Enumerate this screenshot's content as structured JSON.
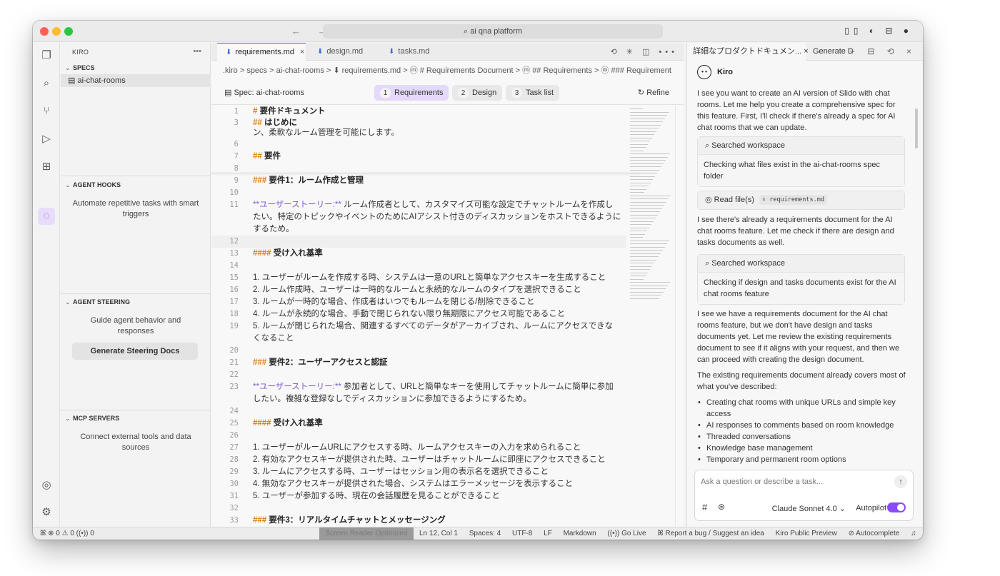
{
  "titlebar": {
    "nav": "← →",
    "search": "⌕ ai qna platform",
    "right_icons": "▯▯ ◐ ⊟ ●"
  },
  "activity": {
    "icons": [
      "explorer-icon",
      "search-icon",
      "source-control-icon",
      "run-debug-icon",
      "extensions-icon",
      "kiro-ghost-icon",
      "account-icon",
      "settings-icon"
    ]
  },
  "sidebar": {
    "header": "KIRO",
    "more": "•••",
    "specs": {
      "title": "SPECS",
      "item": "ai-chat-rooms"
    },
    "hooks": {
      "title": "AGENT HOOKS",
      "desc": "Automate repetitive tasks with smart triggers"
    },
    "steering": {
      "title": "AGENT STEERING",
      "desc": "Guide agent behavior and responses",
      "button": "Generate Steering Docs"
    },
    "mcp": {
      "title": "MCP SERVERS",
      "desc": "Connect external tools and data sources"
    }
  },
  "editor": {
    "tabs": [
      {
        "label": "requirements.md",
        "close": "×"
      },
      {
        "label": "design.md"
      },
      {
        "label": "tasks.md"
      }
    ],
    "tab_actions": "⟲ ✳ ◫ •••",
    "breadcrumb": ".kiro > specs > ai-chat-rooms > ⬇ requirements.md > ⓜ # Requirements Document > ⓜ ## Requirements > ⓜ ### Requirement",
    "spec_label": "Spec: ai-chat-rooms",
    "steps": [
      {
        "num": "1",
        "label": "Requirements"
      },
      {
        "num": "2",
        "label": "Design"
      },
      {
        "num": "3",
        "label": "Task list"
      }
    ],
    "refine": "↻ Refine",
    "lines": [
      {
        "n": "1",
        "hash": "#",
        "text": "要件ドキュメント"
      },
      {
        "n": "3",
        "hash": "##",
        "text": "はじめに"
      },
      {
        "n": "",
        "text": "ン、柔軟なルーム管理を可能にします。"
      },
      {
        "n": "6",
        "text": ""
      },
      {
        "n": "7",
        "hash": "##",
        "text": "要件"
      },
      {
        "n": "8",
        "text": ""
      },
      {
        "n": "9",
        "hash": "###",
        "text": "要件1：ルーム作成と管理"
      },
      {
        "n": "10",
        "text": ""
      },
      {
        "n": "11",
        "bold": "**ユーザーストーリー:**",
        "text": "ルーム作成者として、カスタマイズ可能な設定でチャットルームを作成し"
      },
      {
        "n": "",
        "text": "たい。特定のトピックやイベントのためにAIアシスト付きのディスカッションをホストできるように"
      },
      {
        "n": "",
        "text": "するため。"
      },
      {
        "n": "12",
        "text": ""
      },
      {
        "n": "13",
        "hash": "####",
        "text": "受け入れ基準"
      },
      {
        "n": "14",
        "text": ""
      },
      {
        "n": "15",
        "text": "1. ユーザーがルームを作成する時、システムは一意のURLと簡単なアクセスキーを生成すること"
      },
      {
        "n": "16",
        "text": "2. ルーム作成時、ユーザーは一時的なルームと永続的なルームのタイプを選択できること"
      },
      {
        "n": "17",
        "text": "3. ルームが一時的な場合、作成者はいつでもルームを閉じる/削除できること"
      },
      {
        "n": "18",
        "text": "4. ルームが永続的な場合、手動で閉じられない限り無期限にアクセス可能であること"
      },
      {
        "n": "19",
        "text": "5. ルームが閉じられた場合、関連するすべてのデータがアーカイブされ、ルームにアクセスできな"
      },
      {
        "n": "",
        "text": "くなること"
      },
      {
        "n": "20",
        "text": ""
      },
      {
        "n": "21",
        "hash": "###",
        "text": "要件2：ユーザーアクセスと認証"
      },
      {
        "n": "22",
        "text": ""
      },
      {
        "n": "23",
        "bold": "**ユーザーストーリー:**",
        "text": "参加者として、URLと簡単なキーを使用してチャットルームに簡単に参加"
      },
      {
        "n": "",
        "text": "したい。複雑な登録なしでディスカッションに参加できるようにするため。"
      },
      {
        "n": "24",
        "text": ""
      },
      {
        "n": "25",
        "hash": "####",
        "text": "受け入れ基準"
      },
      {
        "n": "26",
        "text": ""
      },
      {
        "n": "27",
        "text": "1. ユーザーがルームURLにアクセスする時、ルームアクセスキーの入力を求められること"
      },
      {
        "n": "28",
        "text": "2. 有効なアクセスキーが提供された時、ユーザーはチャットルームに即座にアクセスできること"
      },
      {
        "n": "29",
        "text": "3. ルームにアクセスする時、ユーザーはセッション用の表示名を選択できること"
      },
      {
        "n": "30",
        "text": "4. 無効なアクセスキーが提供された場合、システムはエラーメッセージを表示すること"
      },
      {
        "n": "31",
        "text": "5. ユーザーが参加する時、現在の会話履歴を見ることができること"
      },
      {
        "n": "32",
        "text": ""
      },
      {
        "n": "33",
        "hash": "###",
        "text": "要件3：リアルタイムチャットとメッセージング"
      }
    ]
  },
  "chat": {
    "tab_active": "詳細なプロダクトドキュメン...",
    "tab_active_close": "×",
    "tab_second": "Generate D",
    "actions": "+ ⊟ ⟲ ×",
    "agent_name": "Kiro",
    "agent_face": "• •",
    "msg1": "I see you want to create an AI version of Slido with chat rooms. Let me help you create a comprehensive spec for this feature. First, I'll check if there's already a spec for AI chat rooms that we can update.",
    "tool1_head": "⌕ Searched workspace",
    "tool1_body": "Checking what files exist in the ai-chat-rooms spec folder",
    "tool2_head": "◎ Read file(s)",
    "tool2_chip": "⬇ requirements.md",
    "msg2": "I see there's already a requirements document for the AI chat rooms feature. Let me check if there are design and tasks documents as well.",
    "tool3_head": "⌕ Searched workspace",
    "tool3_body": "Checking if design and tasks documents exist for the AI chat rooms feature",
    "msg3": "I see we have a requirements document for the AI chat rooms feature, but we don't have design and tasks documents yet. Let me review the existing requirements document to see if it aligns with your request, and then we can proceed with creating the design document.",
    "msg4": "The existing requirements document already covers most of what you've described:",
    "bullets": [
      "Creating chat rooms with unique URLs and simple key access",
      "AI responses to comments based on room knowledge",
      "Threaded conversations",
      "Knowledge base management",
      "Temporary and permanent room options"
    ],
    "input_placeholder": "Ask a question or describe a task...",
    "send": "↑",
    "hash": "#",
    "img": "⊛",
    "model": "Claude Sonnet 4.0 ⌄",
    "autopilot": "Autopilot"
  },
  "status": {
    "left": "ꕤ   ⊗ 0 ⚠ 0   ((•)) 0",
    "screen_reader": "Screen Reader Optimized",
    "position": "Ln 12, Col 1",
    "spaces": "Spaces: 4",
    "encoding": "UTF-8",
    "eol": "LF",
    "language": "Markdown",
    "golive": "((•)) Go Live",
    "bug": "ꕤ Report a bug / Suggest an idea",
    "preview": "Kiro Public Preview",
    "autocomplete": "⊘ Autocomplete",
    "bell": "♫"
  }
}
